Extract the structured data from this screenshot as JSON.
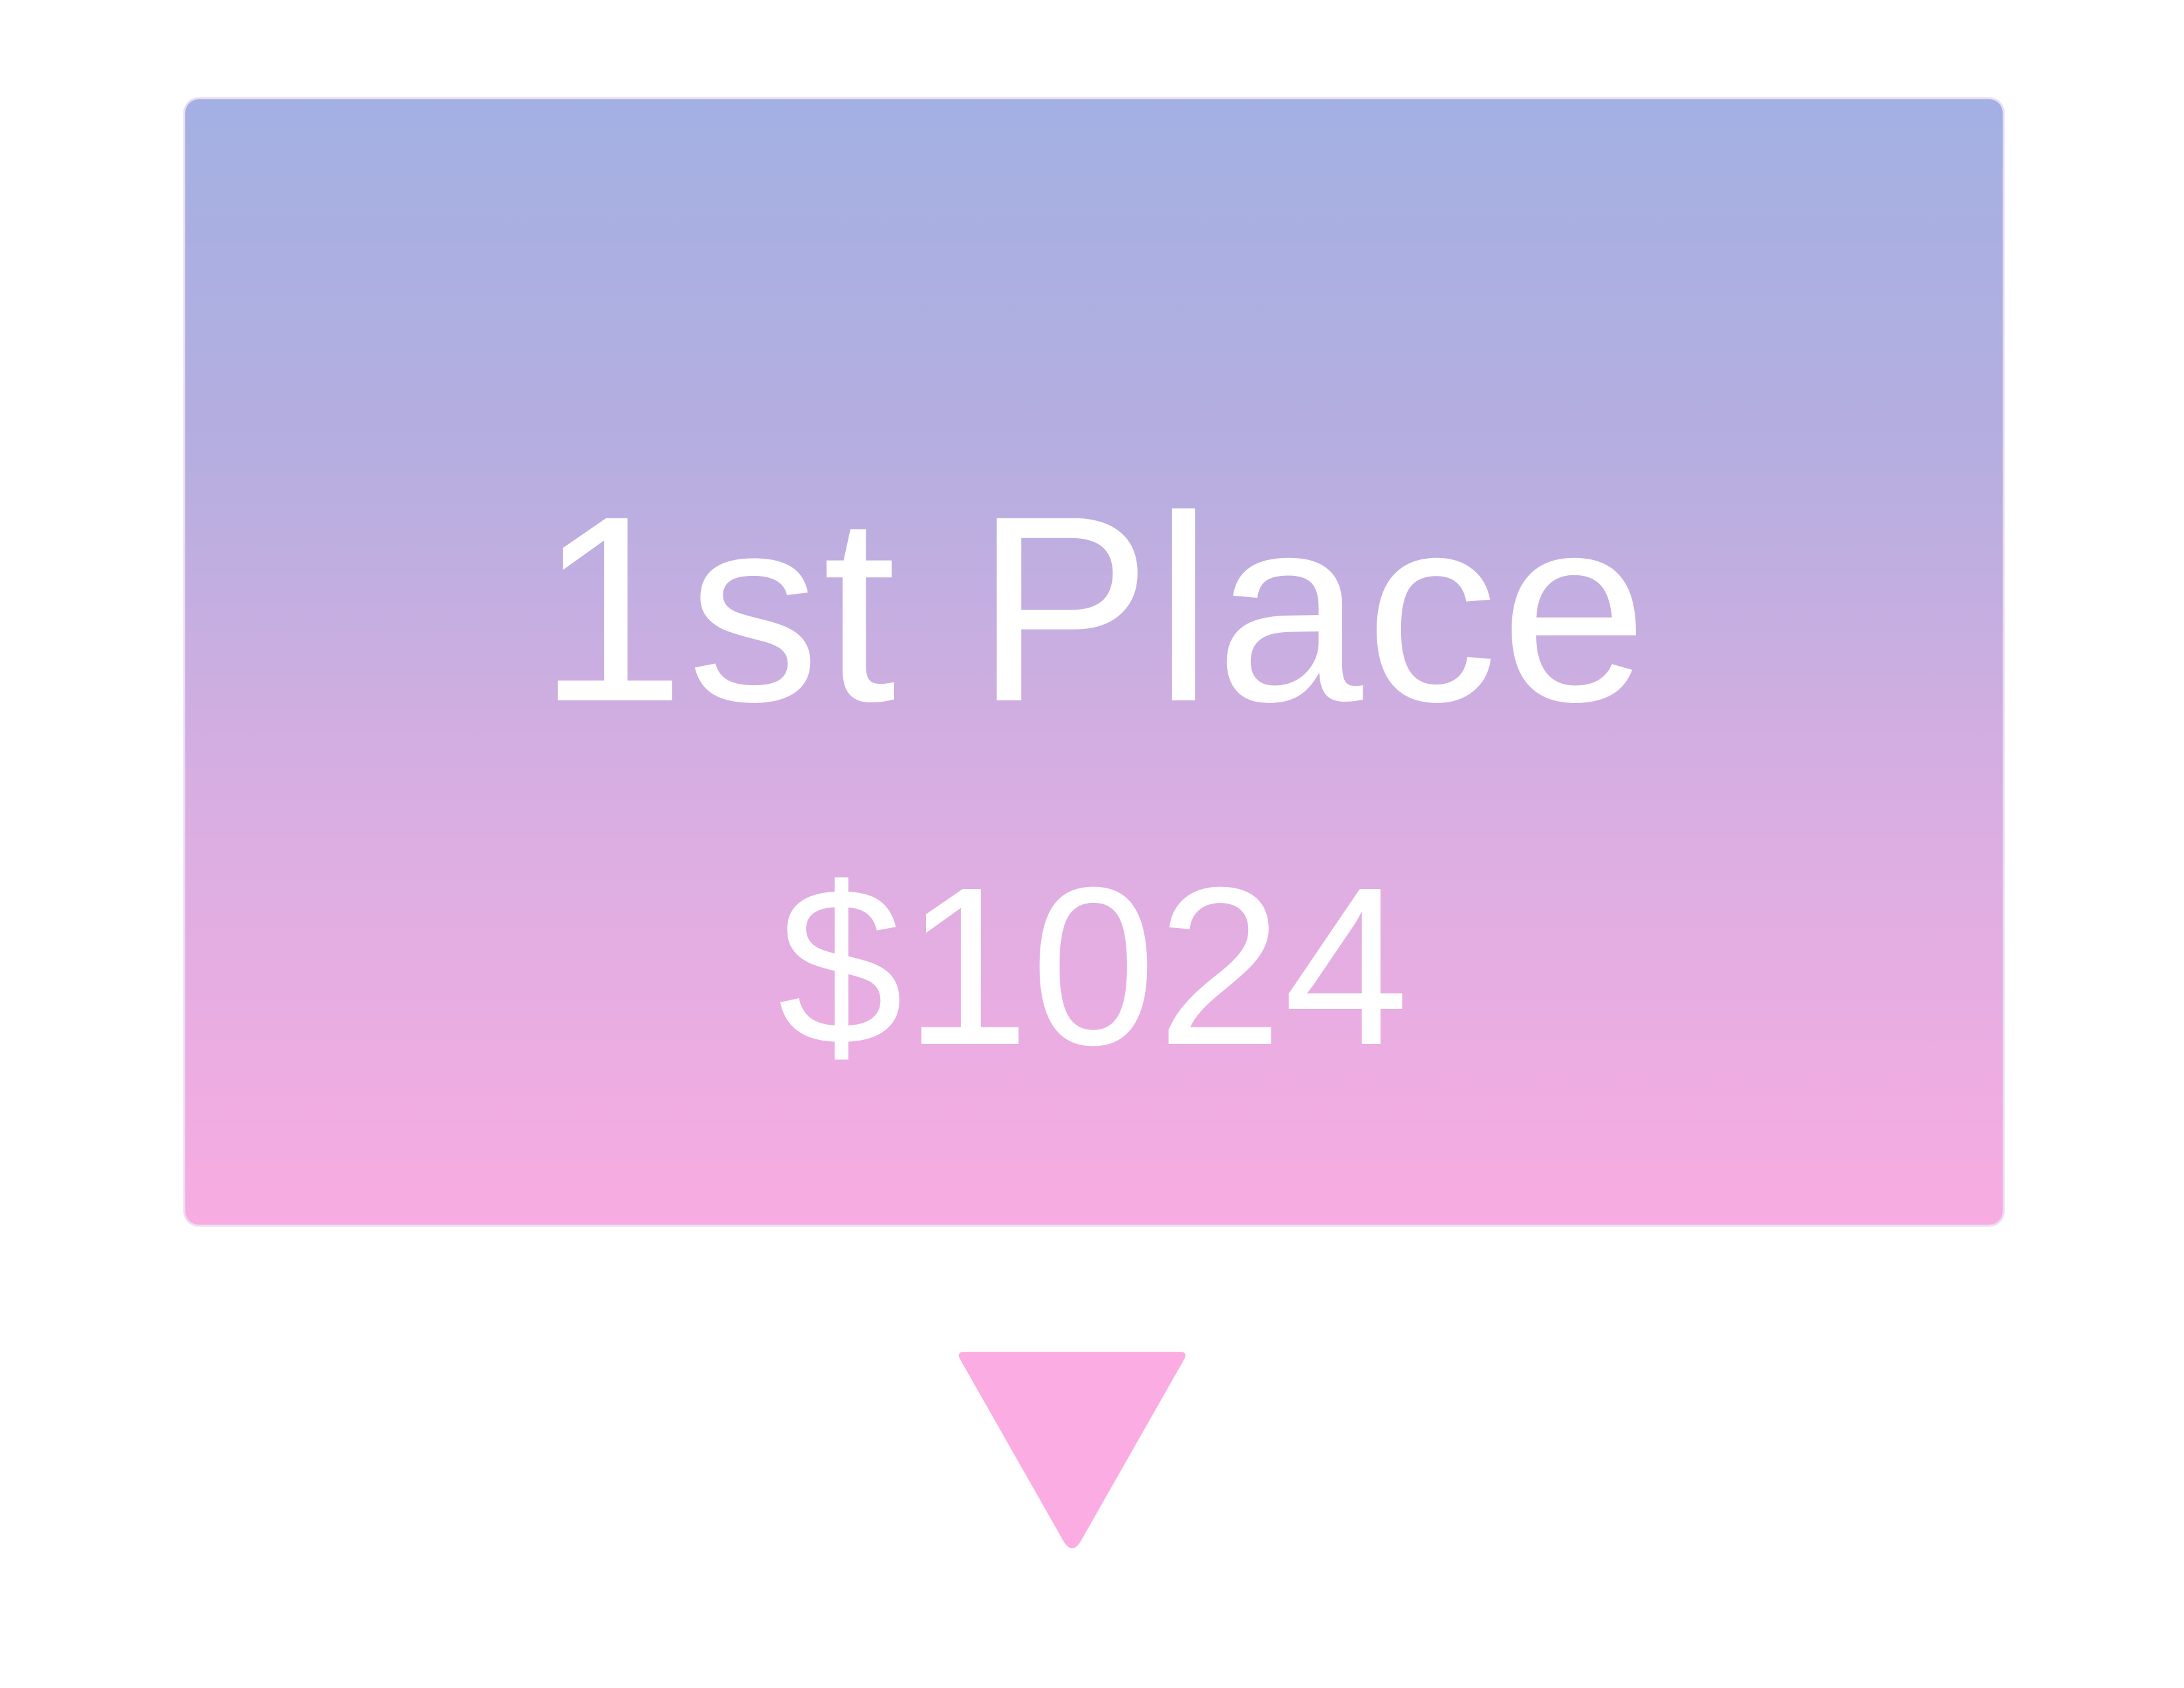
{
  "card": {
    "title": "1st Place",
    "amount": "$1024"
  },
  "colors": {
    "gradient_top": "#a3b0e3",
    "gradient_bottom": "#f8ace1",
    "text": "#ffffff",
    "pointer": "#fbade3"
  },
  "icons": {
    "pointer": "down-triangle-icon"
  }
}
